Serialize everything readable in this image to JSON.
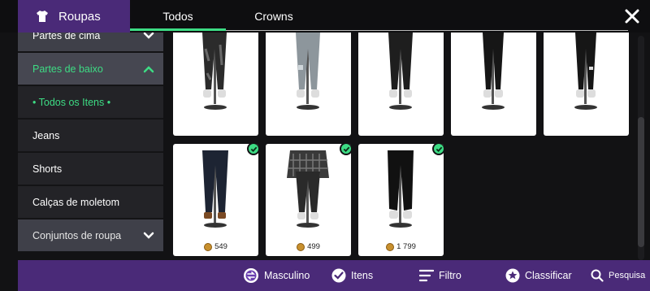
{
  "header": {
    "title": "Roupas",
    "title_icon": "shirt-icon",
    "tabs": [
      {
        "label": "Todos",
        "active": true
      },
      {
        "label": "Crowns",
        "active": false
      }
    ],
    "close_icon": "close-icon"
  },
  "sidebar": {
    "items": [
      {
        "label": "Partes de cima",
        "kind": "category",
        "state": "collapsed"
      },
      {
        "label": "Partes de baixo",
        "kind": "category",
        "state": "expanded"
      },
      {
        "label": "•   Todos os Itens   •",
        "kind": "selected-sub"
      },
      {
        "label": "Jeans",
        "kind": "sub"
      },
      {
        "label": "Shorts",
        "kind": "sub"
      },
      {
        "label": "Calças de moletom",
        "kind": "sub"
      },
      {
        "label": "Conjuntos de roupa",
        "kind": "category",
        "state": "collapsed"
      }
    ]
  },
  "grid": {
    "items": [
      {
        "style": "dark-camo",
        "price": "",
        "owned": false
      },
      {
        "style": "light-gray-denim",
        "price": "",
        "owned": false
      },
      {
        "style": "black",
        "price": "",
        "owned": false
      },
      {
        "style": "black-slim",
        "price": "",
        "owned": false
      },
      {
        "style": "black-ripped",
        "price": "",
        "owned": false
      },
      {
        "style": "dark-blue-jeans",
        "price": "549",
        "owned": true
      },
      {
        "style": "plaid-tied",
        "price": "499",
        "owned": true
      },
      {
        "style": "black-joggers",
        "price": "1 799",
        "owned": true
      }
    ]
  },
  "bottombar": {
    "gender": {
      "label": "Masculino",
      "icon": "swap-gender-icon"
    },
    "items": {
      "label": "Itens",
      "icon": "check-circle-icon"
    },
    "filter": {
      "label": "Filtro",
      "icon": "filter-icon"
    },
    "sort": {
      "label": "Classificar",
      "icon": "sort-icon"
    },
    "search": {
      "label": "Pesquisa",
      "icon": "search-icon"
    }
  },
  "colors": {
    "accent": "#3ddc84",
    "purple": "#4a2a78",
    "background": "#121214"
  }
}
